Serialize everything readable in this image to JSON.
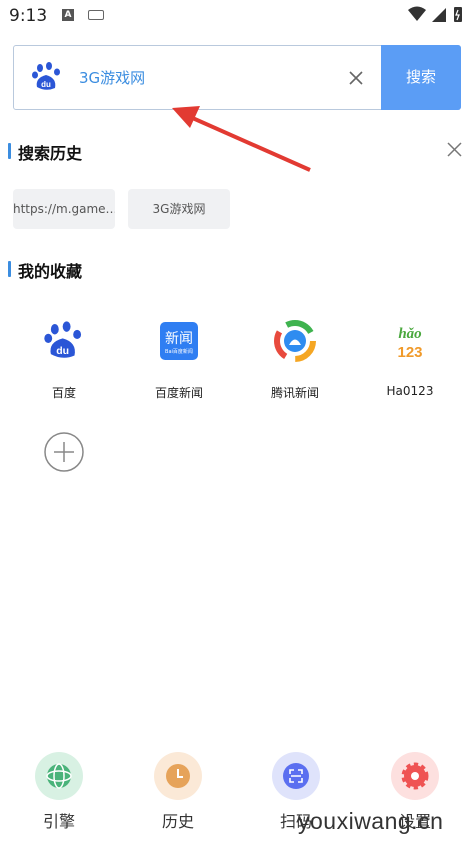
{
  "status_bar": {
    "time": "9:13",
    "notif_letter": "A"
  },
  "search": {
    "value": "3G游戏网",
    "button_label": "搜索"
  },
  "history": {
    "title": "搜索历史",
    "items": [
      "https://m.game…",
      "3G游戏网"
    ]
  },
  "favorites": {
    "title": "我的收藏",
    "items": [
      {
        "label": "百度",
        "icon": "baidu-icon"
      },
      {
        "label": "百度新闻",
        "icon": "baidu-news-icon"
      },
      {
        "label": "腾讯新闻",
        "icon": "tencent-news-icon"
      },
      {
        "label": "Ha0123",
        "icon": "hao123-icon"
      }
    ],
    "hao_logo_top": "hǎo",
    "hao_logo_bottom": "123",
    "news_logo_top": "新闻",
    "news_logo_bottom": "Bai百度新闻"
  },
  "bottom_nav": [
    {
      "label": "引擎",
      "icon": "engine-globe-icon",
      "color": "#4ab37a"
    },
    {
      "label": "历史",
      "icon": "clock-icon",
      "color": "#e6a35a"
    },
    {
      "label": "扫码",
      "icon": "scan-icon",
      "color": "#5b6ff0"
    },
    {
      "label": "设置",
      "icon": "gear-icon",
      "color": "#ef5353"
    }
  ],
  "watermark": "youxiwang.cn",
  "colors": {
    "accent": "#5b9df5",
    "link": "#3b8de0",
    "arrow": "#e23a32"
  }
}
